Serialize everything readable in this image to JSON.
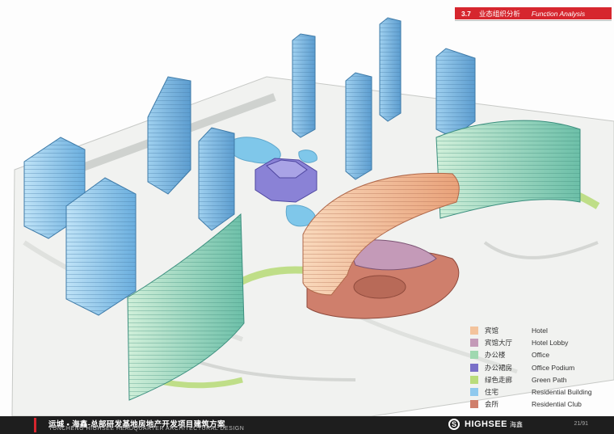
{
  "header": {
    "section_number": "3.7",
    "section_title_cn": "业态组织分析",
    "section_title_en": "Function Analysis",
    "accent_color": "#d6262e"
  },
  "legend": {
    "items": [
      {
        "cn": "宾馆",
        "en": "Hotel",
        "color": "#f3c39c"
      },
      {
        "cn": "宾馆大厅",
        "en": "Hotel Lobby",
        "color": "#c49ab8"
      },
      {
        "cn": "办公楼",
        "en": "Office",
        "color": "#9fd8b0"
      },
      {
        "cn": "办公裙房",
        "en": "Office Podium",
        "color": "#7a70c8"
      },
      {
        "cn": "绿色走廊",
        "en": "Green Path",
        "color": "#b9dc7c"
      },
      {
        "cn": "住宅",
        "en": "Residential Building",
        "color": "#8fc9ee"
      },
      {
        "cn": "会所",
        "en": "Residential Club",
        "color": "#cf7f6c"
      }
    ]
  },
  "footer": {
    "title_cn": "运城 • 海鑫-总部研发基地房地产开发项目建筑方案",
    "title_en": "YUNCHENG  HIGHSEE HEADQUARTER ARCHITECTURAL DESIGN",
    "logo_en": "HIGHSEE",
    "logo_cn": "海鑫",
    "logo_mark": "S",
    "page_number": "21/91"
  }
}
